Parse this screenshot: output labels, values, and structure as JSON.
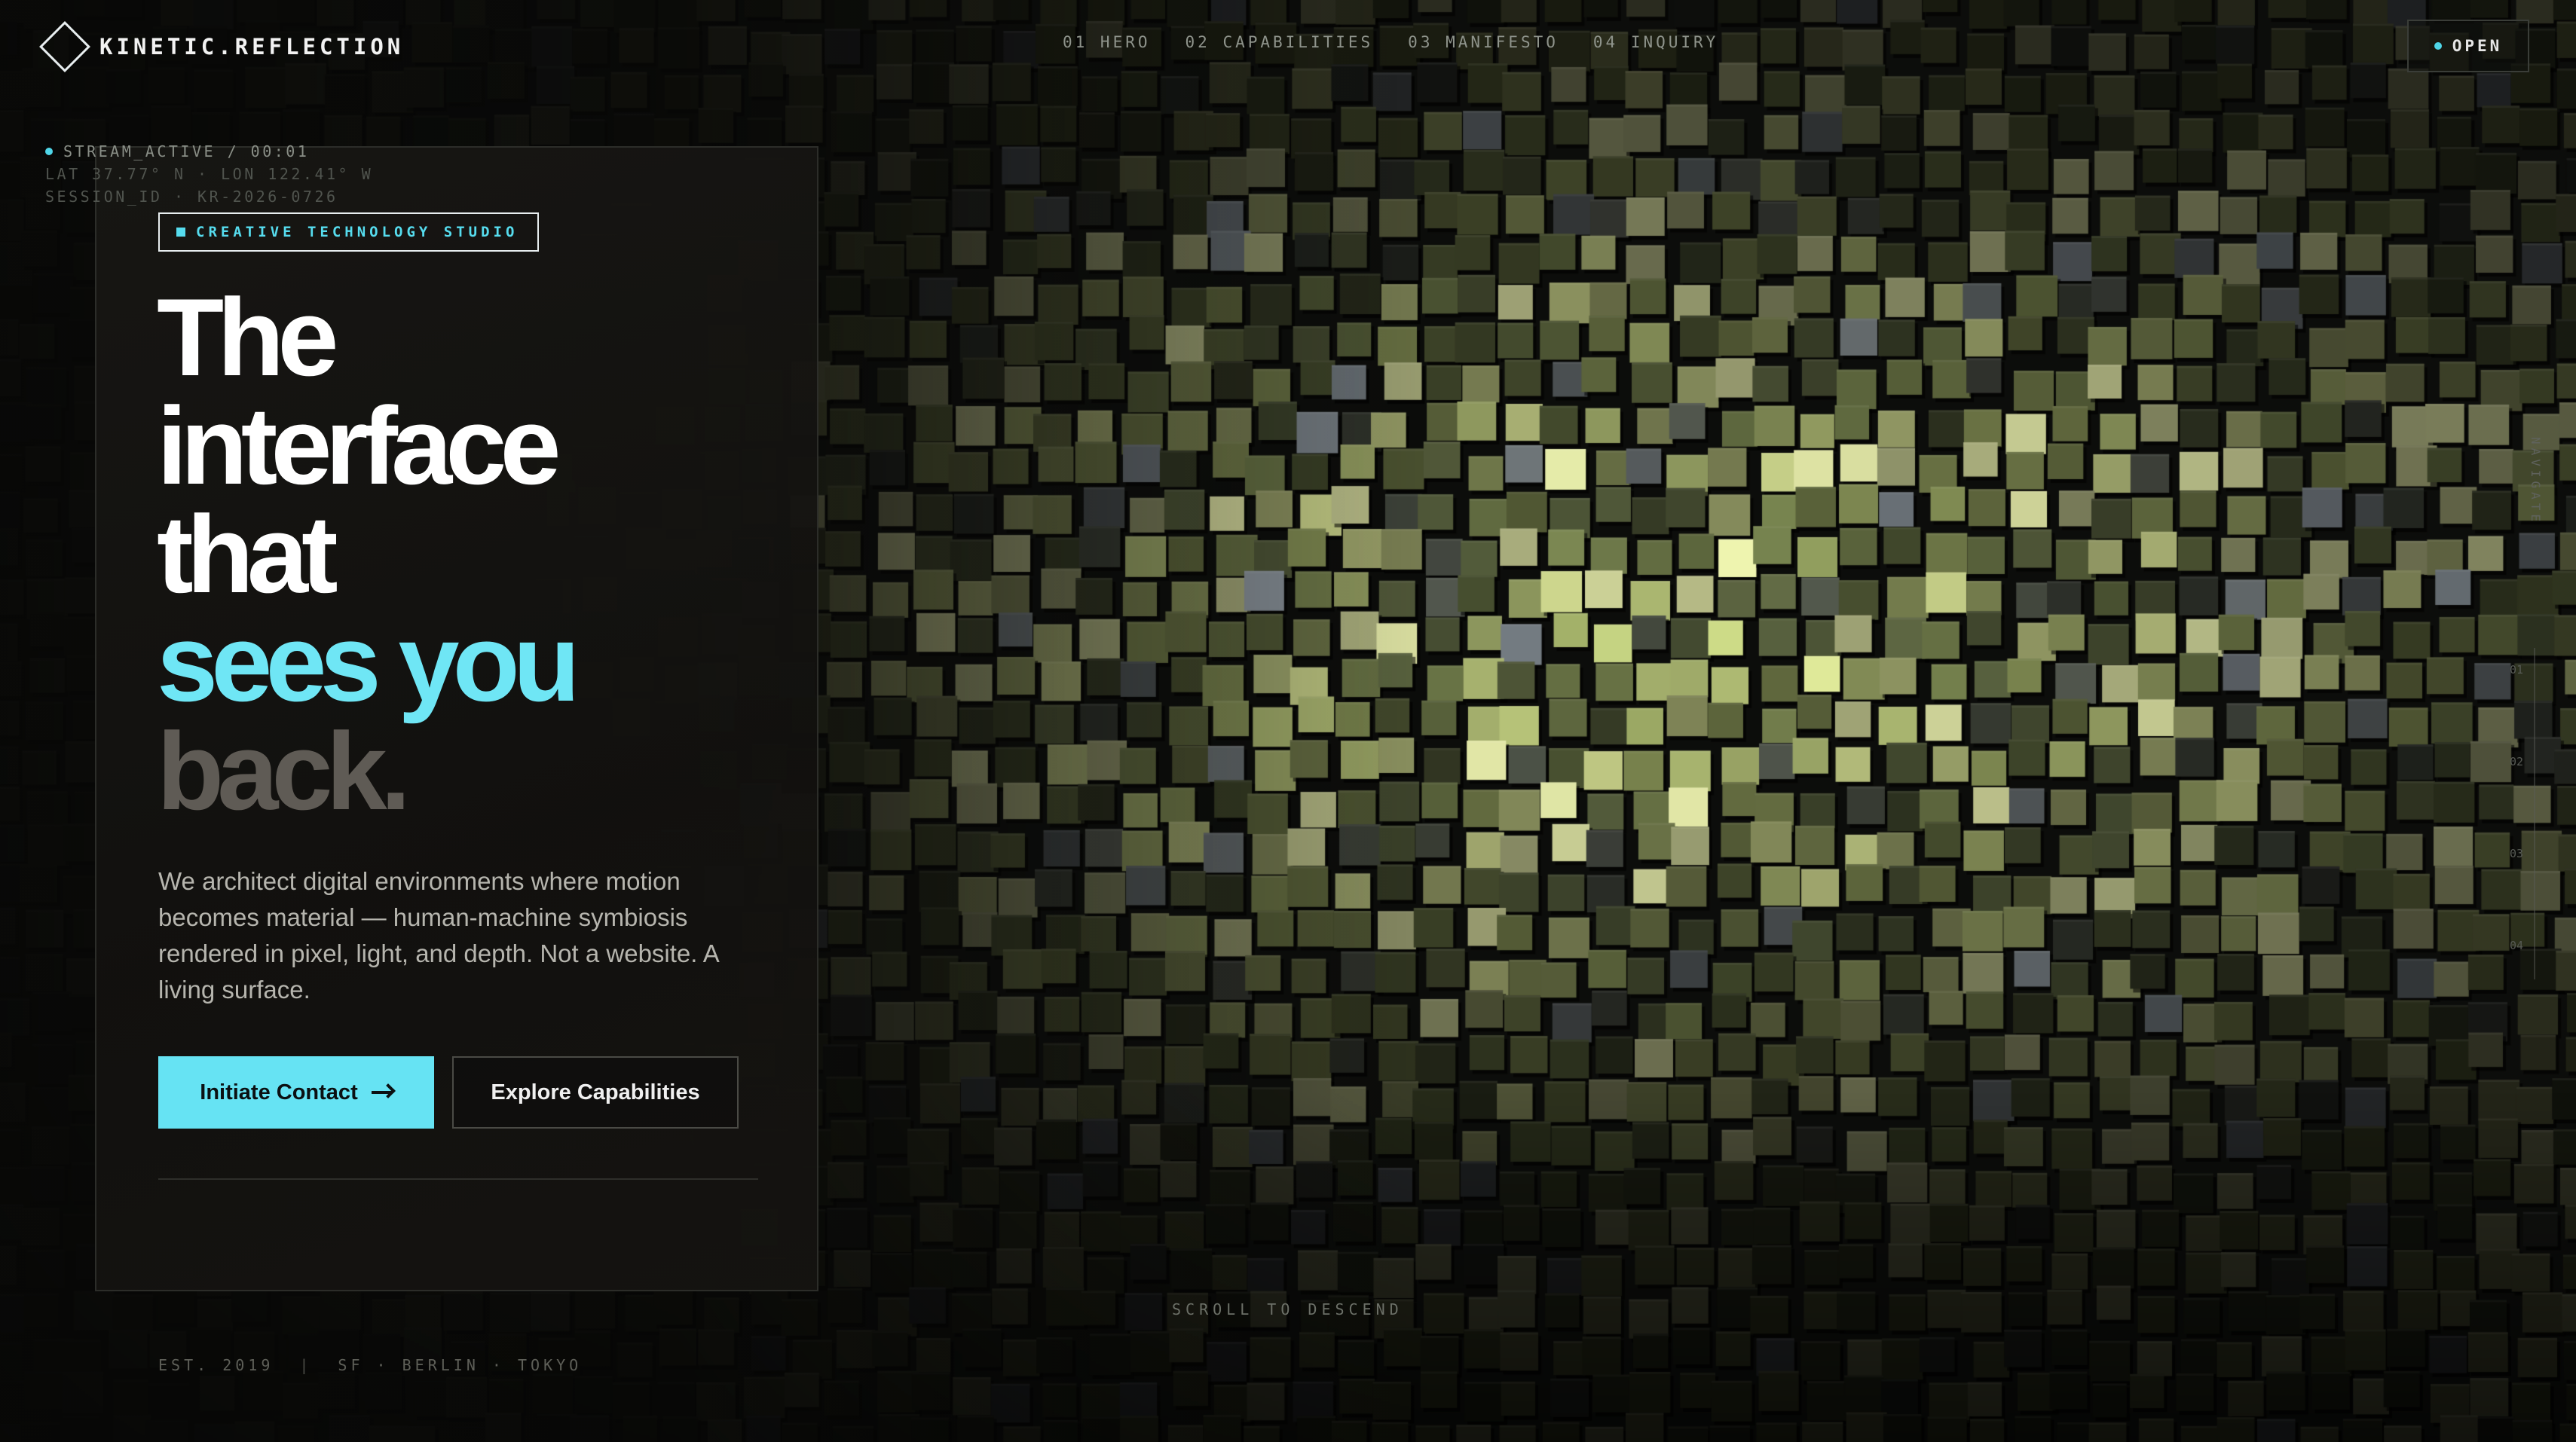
{
  "brand": {
    "name": "KINETIC.REFLECTION"
  },
  "nav": {
    "items": [
      "01 HERO",
      "02 CAPABILITIES",
      "03 MANIFESTO",
      "04 INQUIRY"
    ],
    "open_label": "OPEN"
  },
  "telemetry": {
    "stream": "STREAM_ACTIVE / 00:01",
    "coords": "LAT 37.77° N · LON 122.41° W",
    "session": "SESSION_ID · KR-2026-0726"
  },
  "hero": {
    "tag": "CREATIVE TECHNOLOGY STUDIO",
    "headline": {
      "line1": "The",
      "line2": "interface",
      "line3": "that",
      "line4": "sees you",
      "line5": "back."
    },
    "description": "We architect digital environments where motion becomes material — human-machine symbiosis rendered in pixel, light, and depth. Not a website. A living surface.",
    "primary_cta": "Initiate Contact",
    "secondary_cta": "Explore Capabilities",
    "meta": {
      "established": "EST. 2019",
      "separator": "|",
      "locations": "SF · BERLIN · TOKYO"
    }
  },
  "scroll_hint": "SCROLL TO DESCEND",
  "rail": {
    "label": "NAVIGATE",
    "steps": [
      "01",
      "02",
      "03",
      "04"
    ]
  },
  "colors": {
    "accent": "#66e3f3",
    "background": "#0d0e0c",
    "headline_grey": "#5f5b55"
  }
}
